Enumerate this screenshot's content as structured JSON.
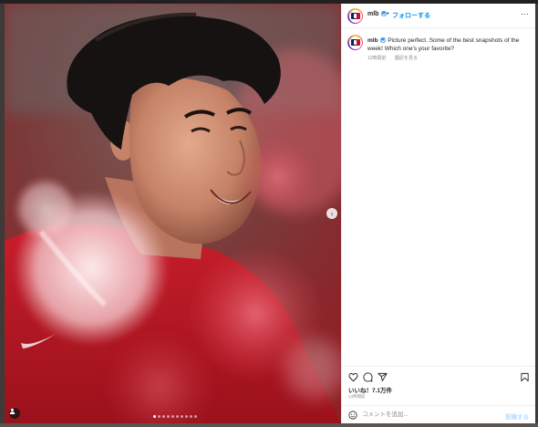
{
  "post": {
    "username": "mlb",
    "separator": "•",
    "follow_label": "フォローする",
    "more_label": "···",
    "caption_user": "mlb",
    "caption_text": "Picture perfect. Some of the best snapshots of the week! Which one's your favorite?",
    "caption_time": "12時間前",
    "caption_translate": "翻訳を見る",
    "likes_label": "いいね！7.1万件",
    "posted_time": "13時間前",
    "comment_placeholder": "コメントを追加...",
    "post_button": "投稿する",
    "carousel_next": "›",
    "carousel_dot_count": 10,
    "carousel_active_index": 1
  },
  "icons": {
    "heart": "heart-icon",
    "comment": "comment-icon",
    "share": "share-icon",
    "save": "bookmark-icon",
    "emoji": "emoji-icon",
    "user_tag": "person-icon",
    "more": "more-icon"
  },
  "colors": {
    "accent_blue": "#0095f6",
    "post_disabled": "#b3dbff",
    "jersey_red": "#c1121f"
  }
}
